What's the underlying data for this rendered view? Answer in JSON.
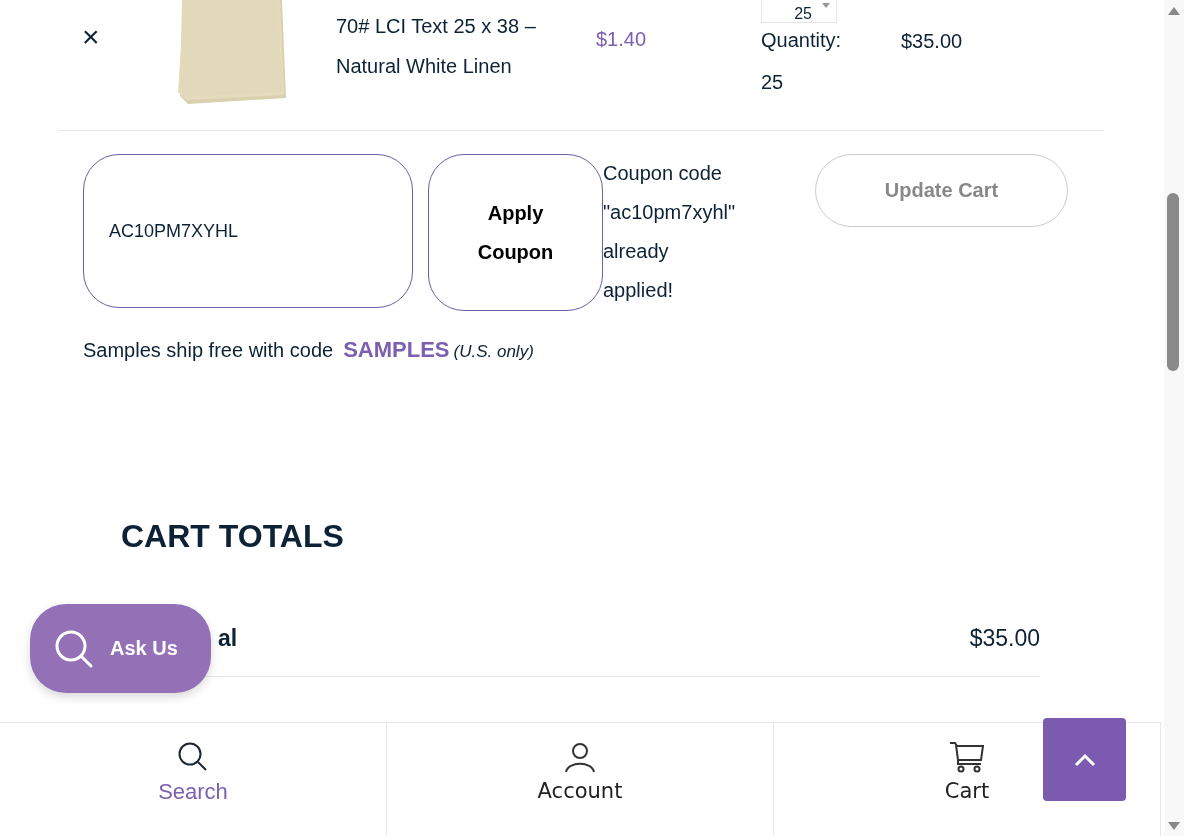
{
  "cart_item": {
    "remove": "×",
    "name": "70# LCI Text 25 x 38 – Natural White Linen",
    "price": "$1.40",
    "quantity_value": "25",
    "quantity_label": "Quantity:",
    "quantity": "25",
    "subtotal": "$35.00"
  },
  "coupon": {
    "value": "AC10PM7XYHL",
    "apply_button": "Apply Coupon",
    "message": "Coupon code \"ac10pm7xyhl\" already applied!"
  },
  "update_button": {
    "label": "Update Cart",
    "disabled": true
  },
  "samples_note": {
    "text": "Samples ship free with code",
    "code": "SAMPLES",
    "suffix": "(U.S. only)"
  },
  "cart_totals": {
    "title": "CART TOTALS",
    "subtotal_label": "al",
    "subtotal_value": "$35.00"
  },
  "ask_us": {
    "label": "Ask Us"
  },
  "bottom_nav": [
    {
      "label": "Search",
      "kind": "search",
      "selected": true
    },
    {
      "label": "Account",
      "kind": "account",
      "selected": false
    },
    {
      "label": "Cart",
      "kind": "cart",
      "selected": false
    }
  ]
}
